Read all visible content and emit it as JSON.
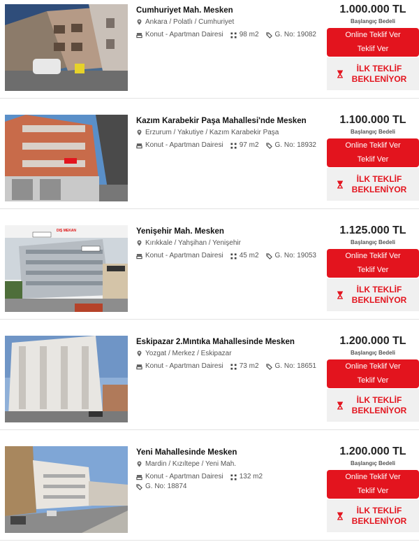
{
  "colors": {
    "accent": "#e3141e",
    "pending_bg": "#f0f0f0"
  },
  "icons": {
    "location": "location-pin-icon",
    "type": "building-icon",
    "area": "area-grid-icon",
    "id": "tag-number-icon",
    "pending": "hourglass-icon"
  },
  "listings": [
    {
      "title": "Cumhuriyet Mah. Mesken",
      "location": "Ankara / Polatlı / Cumhuriyet",
      "type": "Konut - Apartman Dairesi",
      "area": "98 m2",
      "gno": "G. No: 19082",
      "price": "1.000.000 TL",
      "price_label": "Başlangıç Bedeli",
      "btn_online": "Online Teklif Ver",
      "btn_offer": "Teklif Ver",
      "pending": "İLK TEKLİF BEKLENİYOR"
    },
    {
      "title": "Kazım Karabekir Paşa Mahallesi'nde Mesken",
      "location": "Erzurum / Yakutiye / Kazım Karabekir Paşa",
      "type": "Konut - Apartman Dairesi",
      "area": "97 m2",
      "gno": "G. No: 18932",
      "price": "1.100.000 TL",
      "price_label": "Başlangıç Bedeli",
      "btn_online": "Online Teklif Ver",
      "btn_offer": "Teklif Ver",
      "pending": "İLK TEKLİF BEKLENİYOR"
    },
    {
      "title": "Yenişehir Mah. Mesken",
      "location": "Kırıkkale / Yahşihan / Yenişehir",
      "type": "Konut - Apartman Dairesi",
      "area": "45 m2",
      "gno": "G. No: 19053",
      "price": "1.125.000 TL",
      "price_label": "Başlangıç Bedeli",
      "btn_online": "Online Teklif Ver",
      "btn_offer": "Teklif Ver",
      "pending": "İLK TEKLİF BEKLENİYOR",
      "photo_label": "DIŞ MEKAN"
    },
    {
      "title": "Eskipazar 2.Mıntıka Mahallesinde Mesken",
      "location": "Yozgat / Merkez / Eskipazar",
      "type": "Konut - Apartman Dairesi",
      "area": "73 m2",
      "gno": "G. No: 18651",
      "price": "1.200.000 TL",
      "price_label": "Başlangıç Bedeli",
      "btn_online": "Online Teklif Ver",
      "btn_offer": "Teklif Ver",
      "pending": "İLK TEKLİF BEKLENİYOR"
    },
    {
      "title": "Yeni Mahallesinde Mesken",
      "location": "Mardin / Kızıltepe / Yeni Mah.",
      "type": "Konut - Apartman Dairesi",
      "area": "132 m2",
      "gno": "G. No: 18874",
      "price": "1.200.000 TL",
      "price_label": "Başlangıç Bedeli",
      "btn_online": "Online Teklif Ver",
      "btn_offer": "Teklif Ver",
      "pending": "İLK TEKLİF BEKLENİYOR"
    }
  ]
}
